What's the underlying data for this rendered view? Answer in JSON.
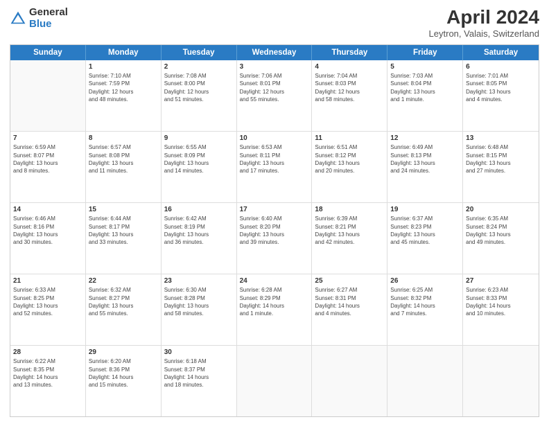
{
  "logo": {
    "general": "General",
    "blue": "Blue"
  },
  "title": "April 2024",
  "subtitle": "Leytron, Valais, Switzerland",
  "header_days": [
    "Sunday",
    "Monday",
    "Tuesday",
    "Wednesday",
    "Thursday",
    "Friday",
    "Saturday"
  ],
  "weeks": [
    [
      {
        "day": "",
        "info": ""
      },
      {
        "day": "1",
        "info": "Sunrise: 7:10 AM\nSunset: 7:59 PM\nDaylight: 12 hours\nand 48 minutes."
      },
      {
        "day": "2",
        "info": "Sunrise: 7:08 AM\nSunset: 8:00 PM\nDaylight: 12 hours\nand 51 minutes."
      },
      {
        "day": "3",
        "info": "Sunrise: 7:06 AM\nSunset: 8:01 PM\nDaylight: 12 hours\nand 55 minutes."
      },
      {
        "day": "4",
        "info": "Sunrise: 7:04 AM\nSunset: 8:03 PM\nDaylight: 12 hours\nand 58 minutes."
      },
      {
        "day": "5",
        "info": "Sunrise: 7:03 AM\nSunset: 8:04 PM\nDaylight: 13 hours\nand 1 minute."
      },
      {
        "day": "6",
        "info": "Sunrise: 7:01 AM\nSunset: 8:05 PM\nDaylight: 13 hours\nand 4 minutes."
      }
    ],
    [
      {
        "day": "7",
        "info": "Sunrise: 6:59 AM\nSunset: 8:07 PM\nDaylight: 13 hours\nand 8 minutes."
      },
      {
        "day": "8",
        "info": "Sunrise: 6:57 AM\nSunset: 8:08 PM\nDaylight: 13 hours\nand 11 minutes."
      },
      {
        "day": "9",
        "info": "Sunrise: 6:55 AM\nSunset: 8:09 PM\nDaylight: 13 hours\nand 14 minutes."
      },
      {
        "day": "10",
        "info": "Sunrise: 6:53 AM\nSunset: 8:11 PM\nDaylight: 13 hours\nand 17 minutes."
      },
      {
        "day": "11",
        "info": "Sunrise: 6:51 AM\nSunset: 8:12 PM\nDaylight: 13 hours\nand 20 minutes."
      },
      {
        "day": "12",
        "info": "Sunrise: 6:49 AM\nSunset: 8:13 PM\nDaylight: 13 hours\nand 24 minutes."
      },
      {
        "day": "13",
        "info": "Sunrise: 6:48 AM\nSunset: 8:15 PM\nDaylight: 13 hours\nand 27 minutes."
      }
    ],
    [
      {
        "day": "14",
        "info": "Sunrise: 6:46 AM\nSunset: 8:16 PM\nDaylight: 13 hours\nand 30 minutes."
      },
      {
        "day": "15",
        "info": "Sunrise: 6:44 AM\nSunset: 8:17 PM\nDaylight: 13 hours\nand 33 minutes."
      },
      {
        "day": "16",
        "info": "Sunrise: 6:42 AM\nSunset: 8:19 PM\nDaylight: 13 hours\nand 36 minutes."
      },
      {
        "day": "17",
        "info": "Sunrise: 6:40 AM\nSunset: 8:20 PM\nDaylight: 13 hours\nand 39 minutes."
      },
      {
        "day": "18",
        "info": "Sunrise: 6:39 AM\nSunset: 8:21 PM\nDaylight: 13 hours\nand 42 minutes."
      },
      {
        "day": "19",
        "info": "Sunrise: 6:37 AM\nSunset: 8:23 PM\nDaylight: 13 hours\nand 45 minutes."
      },
      {
        "day": "20",
        "info": "Sunrise: 6:35 AM\nSunset: 8:24 PM\nDaylight: 13 hours\nand 49 minutes."
      }
    ],
    [
      {
        "day": "21",
        "info": "Sunrise: 6:33 AM\nSunset: 8:25 PM\nDaylight: 13 hours\nand 52 minutes."
      },
      {
        "day": "22",
        "info": "Sunrise: 6:32 AM\nSunset: 8:27 PM\nDaylight: 13 hours\nand 55 minutes."
      },
      {
        "day": "23",
        "info": "Sunrise: 6:30 AM\nSunset: 8:28 PM\nDaylight: 13 hours\nand 58 minutes."
      },
      {
        "day": "24",
        "info": "Sunrise: 6:28 AM\nSunset: 8:29 PM\nDaylight: 14 hours\nand 1 minute."
      },
      {
        "day": "25",
        "info": "Sunrise: 6:27 AM\nSunset: 8:31 PM\nDaylight: 14 hours\nand 4 minutes."
      },
      {
        "day": "26",
        "info": "Sunrise: 6:25 AM\nSunset: 8:32 PM\nDaylight: 14 hours\nand 7 minutes."
      },
      {
        "day": "27",
        "info": "Sunrise: 6:23 AM\nSunset: 8:33 PM\nDaylight: 14 hours\nand 10 minutes."
      }
    ],
    [
      {
        "day": "28",
        "info": "Sunrise: 6:22 AM\nSunset: 8:35 PM\nDaylight: 14 hours\nand 13 minutes."
      },
      {
        "day": "29",
        "info": "Sunrise: 6:20 AM\nSunset: 8:36 PM\nDaylight: 14 hours\nand 15 minutes."
      },
      {
        "day": "30",
        "info": "Sunrise: 6:18 AM\nSunset: 8:37 PM\nDaylight: 14 hours\nand 18 minutes."
      },
      {
        "day": "",
        "info": ""
      },
      {
        "day": "",
        "info": ""
      },
      {
        "day": "",
        "info": ""
      },
      {
        "day": "",
        "info": ""
      }
    ]
  ]
}
